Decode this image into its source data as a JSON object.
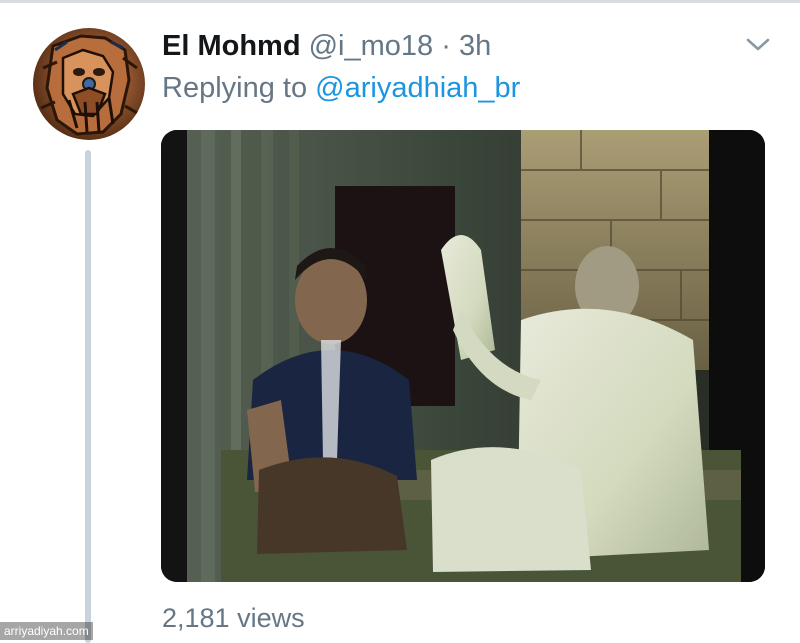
{
  "tweet": {
    "display_name": "El Mohmd",
    "handle": "@i_mo18",
    "separator": "·",
    "timestamp": "3h",
    "replying_prefix": "Replying to",
    "replying_to": "@ariyadhiah_br",
    "views": "2,181 views",
    "menu_icon": "chevron-down-icon"
  },
  "watermark": "arriyadiyah.com",
  "colors": {
    "text_primary": "#14171a",
    "text_secondary": "#657786",
    "link": "#1b95e0",
    "thread_line": "#c9d3dc"
  }
}
